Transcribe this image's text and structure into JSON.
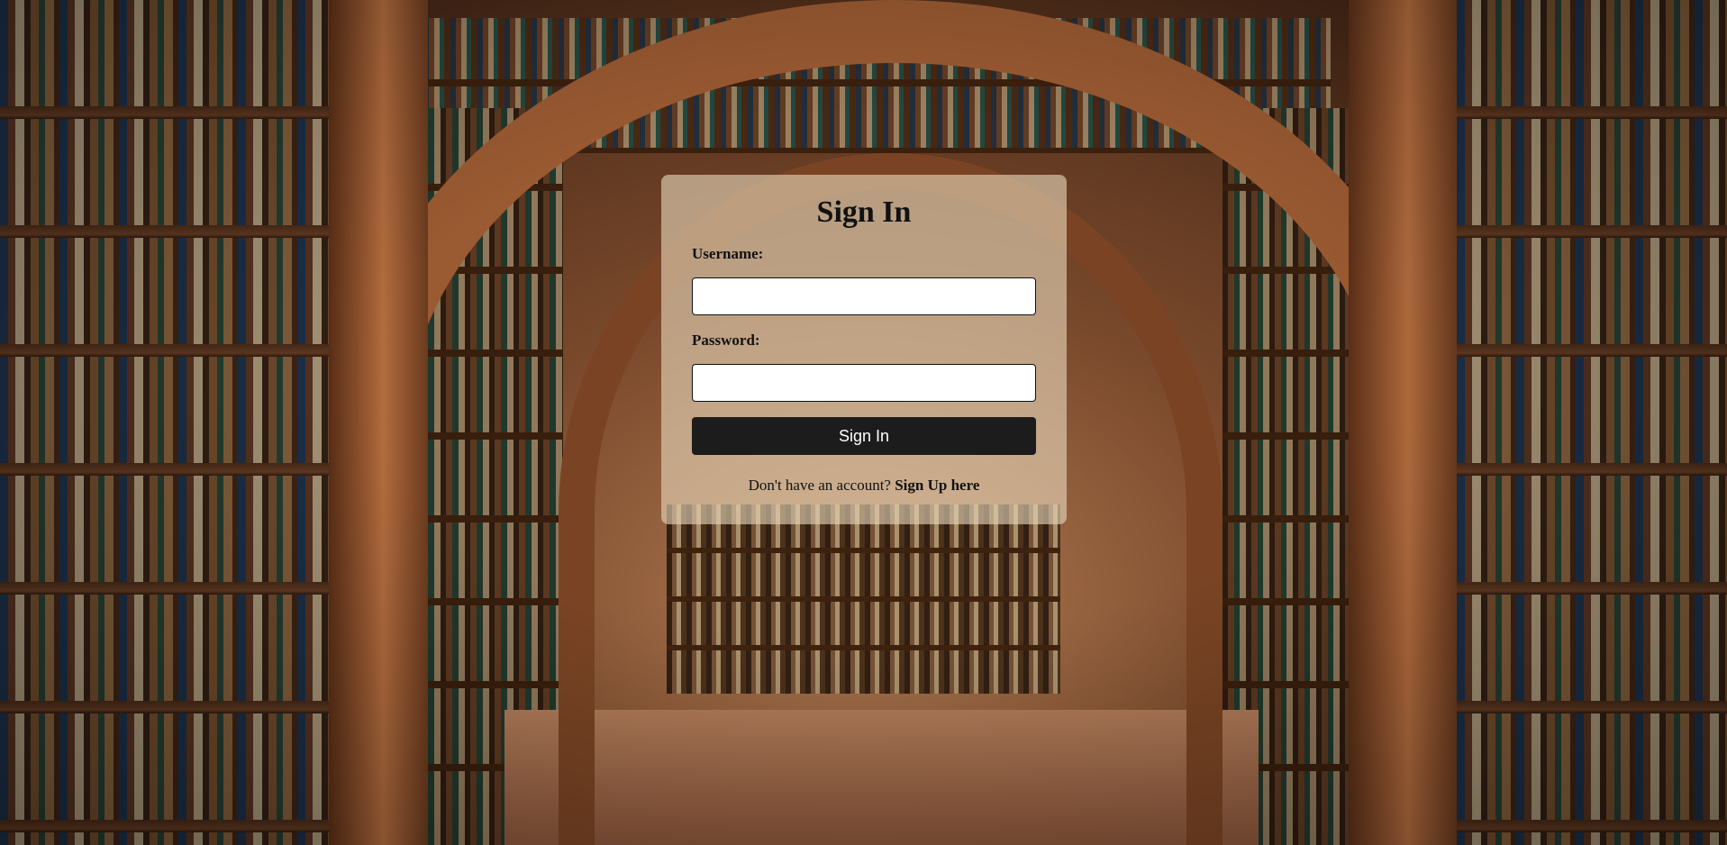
{
  "background": {
    "image": "library-arches-photo"
  },
  "signin": {
    "title": "Sign In",
    "username_label": "Username:",
    "username_value": "",
    "password_label": "Password:",
    "password_value": "",
    "submit_label": "Sign In",
    "signup_prompt": "Don't have an account?",
    "signup_link": "Sign Up here"
  },
  "colors": {
    "card_bg": "#e6d7b9",
    "button_bg": "#1c1c1c",
    "button_text": "#ffffff",
    "text": "#111111"
  }
}
